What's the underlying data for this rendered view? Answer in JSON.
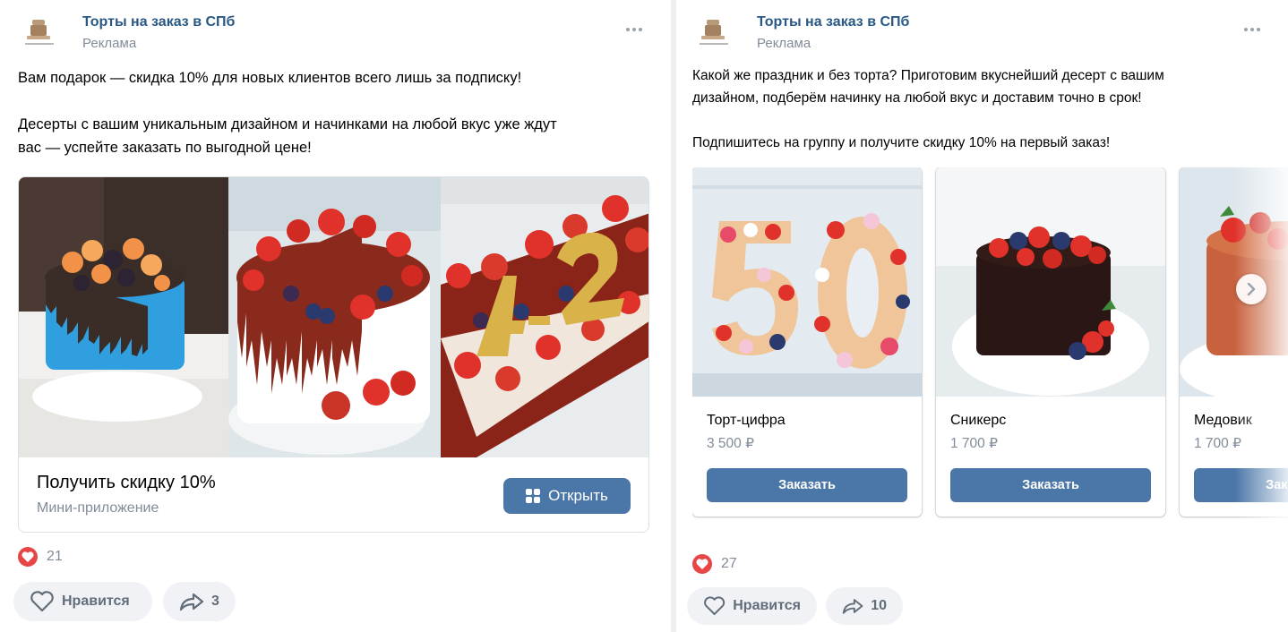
{
  "posts": [
    {
      "group_name": "Торты на заказ в СПб",
      "ad_label": "Реклама",
      "text": "Вам подарок — скидка 10% для новых клиентов всего лишь за подписку!\n\nДесерты с вашим уникальным дизайном и начинками на любой вкус уже ждут\nвас — успейте заказать по выгодной цене!",
      "card": {
        "title": "Получить скидку 10%",
        "subtitle": "Мини-приложение",
        "button_label": "Открыть",
        "button_icon": "mini-app-grid-icon"
      },
      "likes_count": "21",
      "like_label": "Нравится",
      "share_count": "3"
    },
    {
      "group_name": "Торты на заказ в СПб",
      "ad_label": "Реклама",
      "text": "Какой же праздник и без торта? Приготовим вкуснейший десерт с вашим\nдизайном, подберём начинку на любой вкус и доставим точно в срок!\n\nПодпишитесь на группу и получите скидку 10% на первый заказ!",
      "products": [
        {
          "name": "Торт-цифра",
          "price": "3 500 ₽",
          "button": "Заказать"
        },
        {
          "name": "Сникерс",
          "price": "1 700 ₽",
          "button": "Заказать"
        },
        {
          "name": "Медовик",
          "price": "1 700 ₽",
          "button": "Заказать"
        }
      ],
      "likes_count": "27",
      "like_label": "Нравится",
      "share_count": "10"
    }
  ],
  "colors": {
    "link": "#2a5885",
    "button": "#4a76a8",
    "secondary_text": "#818c99",
    "heart": "#e64646"
  }
}
